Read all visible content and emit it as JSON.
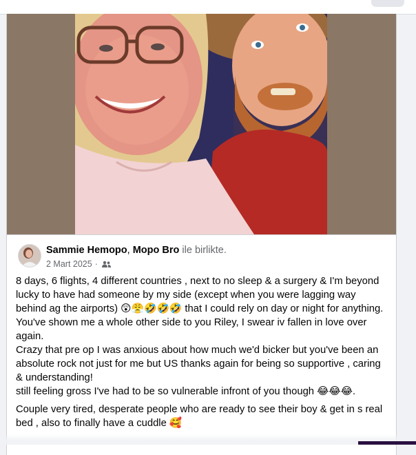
{
  "post": {
    "author": "Sammie Hemopo",
    "separator": ",",
    "tagged": "Mopo Bro",
    "with_text": "ile birlikte.",
    "date": "2 Mart 2025",
    "dot": "·",
    "audience_icon": "friends-icon",
    "paragraphs": [
      "8 days, 6 flights, 4 different countries , next to no sleep & a surgery & I'm beyond lucky to have had someone by my side (except when you were lagging way behind ag the airports) 😲😤🤣🤣🤣 that I could rely on day or night for anything. You've shown me a whole other side to you Riley, I swear iv fallen in love over again.",
      "Crazy that pre op I was anxious about how much we'd bicker but you've been an absolute rock not just for me but US thanks again for being so supportive , caring & understanding!",
      "still feeling gross I've had to be so vulnerable infront of you though 😂😂😂.",
      "Couple very tired, desperate people who are ready to see their boy & get in s real bed , also to finally have a cuddle 🥰"
    ]
  },
  "colors": {
    "photo_background": "#8b7766",
    "text": "#050505",
    "secondary_text": "#65676b"
  }
}
